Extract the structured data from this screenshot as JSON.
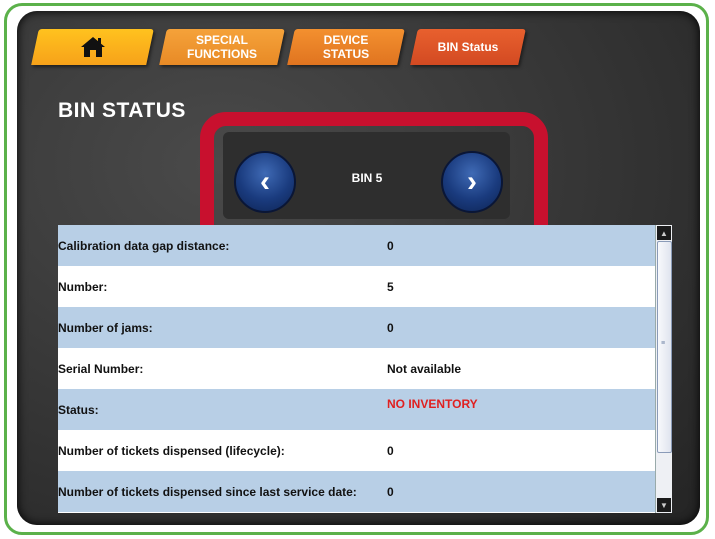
{
  "tabs": {
    "home_icon": "home-icon",
    "special_functions": "SPECIAL\nFUNCTIONS",
    "device_status": "DEVICE\nSTATUS",
    "bin_status": "BIN Status"
  },
  "page": {
    "title": "BIN STATUS"
  },
  "nav": {
    "prev_glyph": "‹",
    "next_glyph": "›",
    "bin_label": "BIN 5"
  },
  "table": {
    "rows": [
      {
        "label": "Calibration data gap distance:",
        "value": "0"
      },
      {
        "label": "Number:",
        "value": "5"
      },
      {
        "label": "Number of jams:",
        "value": "0"
      },
      {
        "label": "Serial Number:",
        "value": "Not available"
      },
      {
        "label": "Status:",
        "value": "NO INVENTORY"
      },
      {
        "label": "Number of tickets dispensed (lifecycle):",
        "value": "0"
      },
      {
        "label": "Number of tickets dispensed since last service date:",
        "value": "0"
      }
    ]
  },
  "colors": {
    "frame_green": "#5bb14a",
    "highlight_red": "#c8102e",
    "status_red": "#e02020",
    "row_blue": "#b8cfe6"
  }
}
